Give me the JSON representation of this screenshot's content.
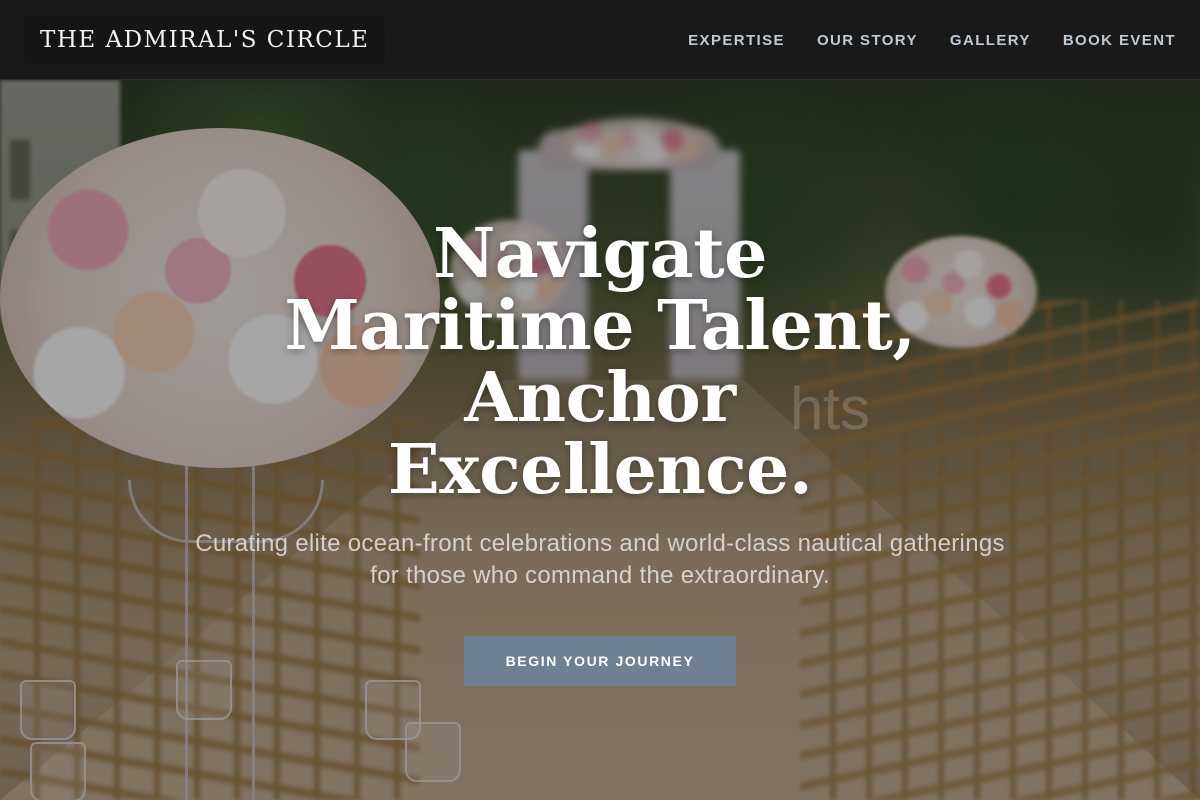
{
  "brand": {
    "name": "THE ADMIRAL'S CIRCLE"
  },
  "nav": {
    "items": [
      {
        "label": "EXPERTISE"
      },
      {
        "label": "OUR STORY"
      },
      {
        "label": "GALLERY"
      },
      {
        "label": "BOOK EVENT"
      }
    ]
  },
  "hero": {
    "headline": "Navigate Maritime Talent, Anchor Excellence.",
    "ghost_text": "hts",
    "subheadline": "Curating elite ocean-front celebrations and world-class nautical gatherings for those who command the extraordinary.",
    "cta_label": "BEGIN YOUR JOURNEY",
    "background_image": "outdoor-wedding-aisle-with-flowers"
  },
  "colors": {
    "nav_background": "#181818",
    "nav_link": "#bfc9d6",
    "cta_background": "#6f7f94",
    "headline": "#ffffff"
  }
}
